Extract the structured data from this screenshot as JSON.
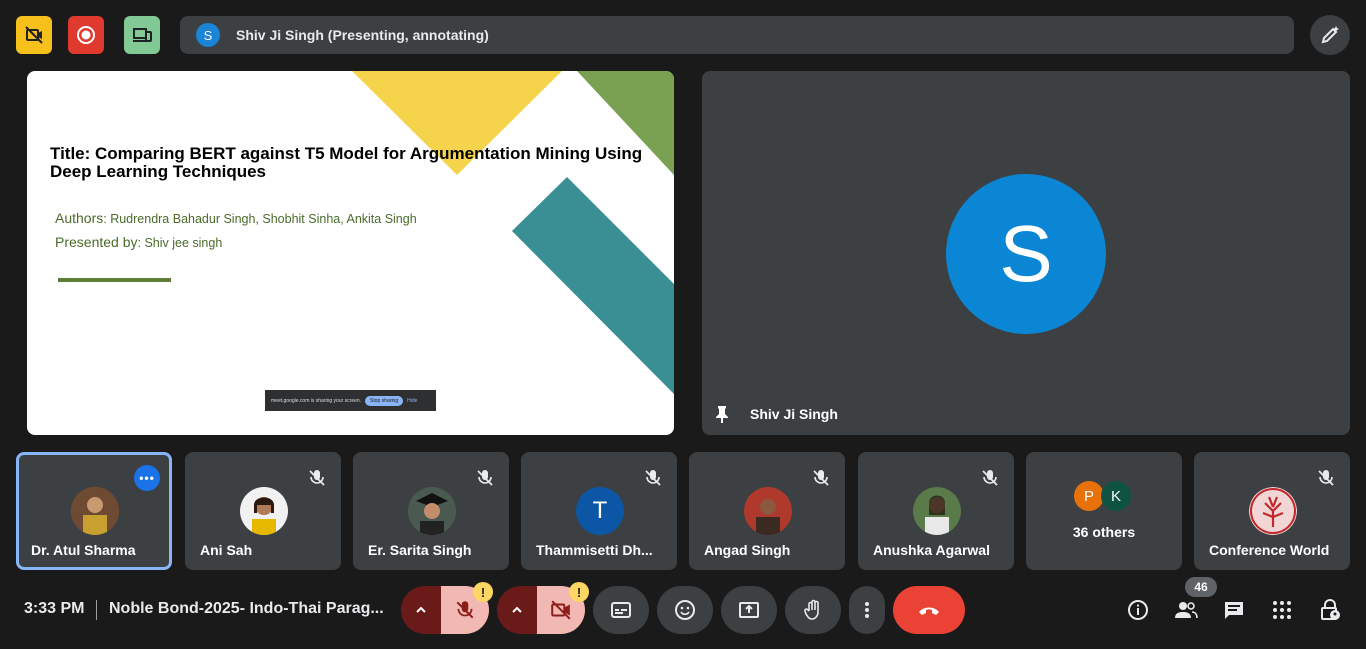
{
  "presenter_bar": {
    "avatar_letter": "S",
    "text": "Shiv Ji Singh (Presenting, annotating)"
  },
  "slide": {
    "title": "Title: Comparing BERT against T5 Model for Argumentation Mining Using Deep Learning Techniques",
    "authors_label": "Authors",
    "authors": ": Rudrendra Bahadur Singh,  Shobhit Sinha,  Ankita Singh",
    "presented_label": "Presented by",
    "presenter": ": Shiv jee singh",
    "share_banner": {
      "text": "meet.google.com is sharing your screen.",
      "stop": "Stop sharing",
      "hide": "Hide"
    }
  },
  "main_tile": {
    "avatar_letter": "S",
    "name": "Shiv Ji Singh"
  },
  "participants": [
    {
      "name": "Dr. Atul Sharma"
    },
    {
      "name": "Ani Sah"
    },
    {
      "name": "Er. Sarita Singh"
    },
    {
      "name": "Thammisetti Dh...",
      "avatar_letter": "T"
    },
    {
      "name": "Angad Singh"
    },
    {
      "name": "Anushka Agarwal"
    },
    {
      "name": "36 others",
      "avatar_letters": [
        "P",
        "K"
      ]
    },
    {
      "name": "Conference World"
    }
  ],
  "bottom": {
    "time": "3:33 PM",
    "meeting_name": "Noble Bond-2025- Indo-Thai Parag...",
    "people_count": "46",
    "warning": "!"
  },
  "colors": {
    "end_call": "#ea4335",
    "active_border": "#8ab4f8"
  }
}
